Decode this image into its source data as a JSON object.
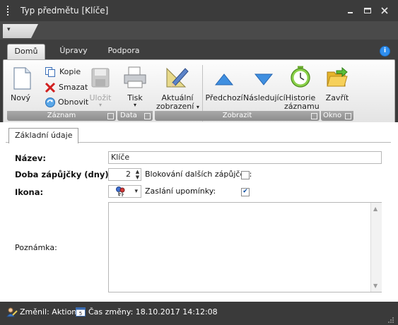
{
  "window": {
    "title": "Typ předmětu [Klíče]"
  },
  "tabs": [
    "Domů",
    "Úpravy",
    "Podpora"
  ],
  "ribbon": {
    "groups": {
      "zaznam": "Záznam",
      "data": "Data",
      "zobrazit": "Zobrazit",
      "okno": "Okno"
    },
    "buttons": {
      "novy": "Nový",
      "kopie": "Kopie",
      "smazat": "Smazat",
      "obnovit": "Obnovit",
      "ulozit": "Uložit",
      "tisk": "Tisk",
      "aktualni_1": "Aktuální",
      "aktualni_2": "zobrazení",
      "predchozi": "Předchozí",
      "nasledujici": "Následující",
      "historie_1": "Historie",
      "historie_2": "záznamu",
      "zavrit": "Zavřít"
    }
  },
  "detail_tab": "Základní údaje",
  "form": {
    "nazev_label": "Název:",
    "nazev_value": "Klíče",
    "doba_label": "Doba zápůjčky (dny):",
    "doba_value": "2",
    "blokovani_label": "Blokování dalších zápůjček:",
    "blokovani_checked": false,
    "ikona_label": "Ikona:",
    "zaslani_label": "Zaslání upomínky:",
    "zaslani_checked": true,
    "poznamka_label": "Poznámka:",
    "poznamka_value": ""
  },
  "status": {
    "changed_by": "Změnil: Aktion",
    "changed_time": "Čas změny: 18.10.2017 14:12:08"
  }
}
